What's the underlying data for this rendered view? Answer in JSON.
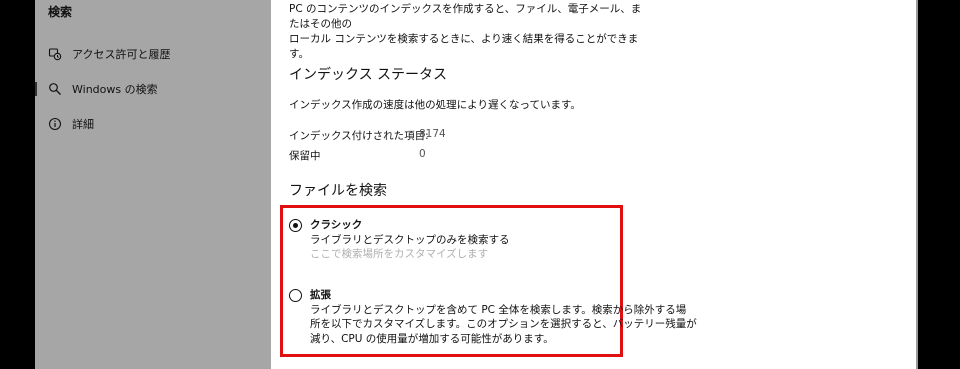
{
  "sidebar": {
    "title": "検索",
    "items": [
      {
        "icon": "history-icon",
        "label": "アクセス許可と履歴",
        "selected": false
      },
      {
        "icon": "search-icon",
        "label": "Windows の検索",
        "selected": true
      },
      {
        "icon": "info-icon",
        "label": "詳細",
        "selected": false
      }
    ]
  },
  "main": {
    "intro_line1": "PC のコンテンツのインデックスを作成すると、ファイル、電子メール、またはその他の",
    "intro_line2": "ローカル コンテンツを検索するときに、より速く結果を得ることができます。",
    "index_status": {
      "heading": "インデックス ステータス",
      "message": "インデックス作成の速度は他の処理により遅くなっています。",
      "indexed_label": "インデックス付けされた項目:",
      "indexed_value": "8174",
      "pending_label": "保留中",
      "pending_value": "0"
    },
    "find_files": {
      "heading": "ファイルを検索",
      "options": [
        {
          "title": "クラシック",
          "description": "ライブラリとデスクトップのみを検索する",
          "link": "ここで検索場所をカスタマイズします",
          "selected": true
        },
        {
          "title": "拡張",
          "description_line1": "ライブラリとデスクトップを含めて PC 全体を検索します。検索から除外する場",
          "description_line2": "所を以下でカスタマイズします。このオプションを選択すると、バッテリー残量が",
          "description_line3": "減り、CPU の使用量が増加する可能性があります。",
          "selected": false
        }
      ]
    }
  },
  "colors": {
    "sidebar_bg": "#a6a6a6",
    "highlight": "#e01010",
    "disabled_text": "#b0b0b0"
  }
}
